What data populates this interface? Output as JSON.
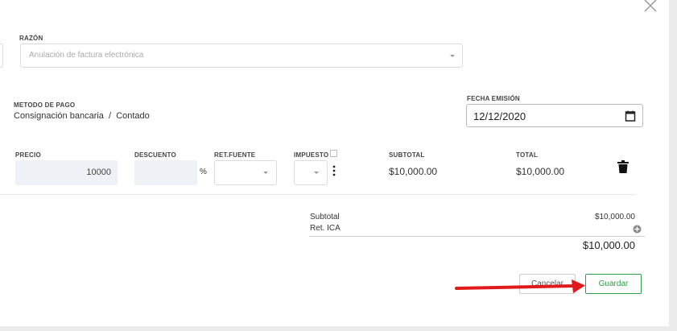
{
  "close_icon": "close-icon",
  "razon": {
    "label": "RAZÓN",
    "placeholder": "Anulación de factura electrónica"
  },
  "payment": {
    "label": "METODO DE PAGO",
    "value": "Consignación bancaria  /  Contado"
  },
  "fecha": {
    "label": "FECHA EMISIÓN",
    "value": "12/12/2020"
  },
  "item_table": {
    "headers": {
      "precio": "PRECIO",
      "descuento": "DESCUENTO",
      "retfuente": "RET.FUENTE",
      "impuesto": "IMPUESTO",
      "subtotal": "SUBTOTAL",
      "total": "TOTAL"
    },
    "row": {
      "precio": "10000",
      "descuento": "",
      "percent": "%",
      "subtotal": "$10,000.00",
      "total": "$10,000.00"
    }
  },
  "summary": {
    "subtotal_label": "Subtotal",
    "subtotal_value": "$10,000.00",
    "retica_label": "Ret. ICA",
    "total_value": "$10,000.00"
  },
  "buttons": {
    "cancel": "Cancelar",
    "save": "Guardar"
  },
  "colors": {
    "save_accent": "#2e9e4a",
    "arrow": "#e0191b"
  }
}
